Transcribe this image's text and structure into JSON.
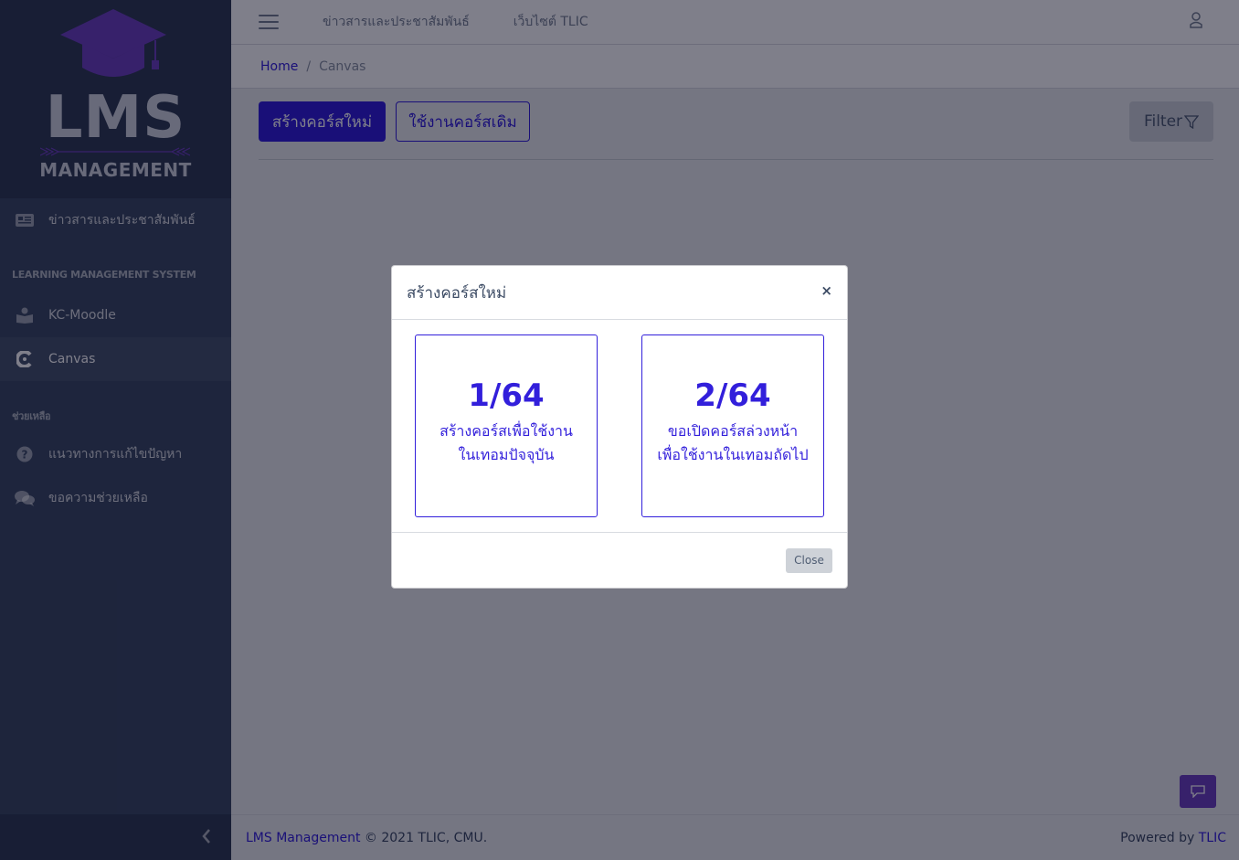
{
  "brand": {
    "title": "LMS",
    "subtitle": "MANAGEMENT"
  },
  "sidebar": {
    "items": [
      {
        "label": "ข่าวสารและประชาสัมพันธ์",
        "icon": "newspaper-icon"
      },
      {
        "label": "KC-Moodle",
        "icon": "reader-icon"
      },
      {
        "label": "Canvas",
        "icon": "canvas-logo-icon",
        "active": true
      },
      {
        "label": "แนวทางการแก้ไขปัญหา",
        "icon": "question-circle-icon"
      },
      {
        "label": "ขอความช่วยเหลือ",
        "icon": "comments-icon"
      }
    ],
    "section_lms": "LEARNING MANAGEMENT SYSTEM",
    "section_help": "ช่วยเหลือ"
  },
  "header": {
    "nav_news": "ข่าวสารและประชาสัมพันธ์",
    "nav_site": "เว็บไซต์ TLIC"
  },
  "breadcrumb": {
    "home": "Home",
    "separator": "/",
    "current": "Canvas"
  },
  "actions": {
    "create_label": "สร้างคอร์สใหม่",
    "existing_label": "ใช้งานคอร์สเดิม",
    "filter_label": "Filter"
  },
  "modal": {
    "title": "สร้างคอร์สใหม่",
    "close_symbol": "×",
    "options": [
      {
        "term": "1/64",
        "line1": "สร้างคอร์สเพื่อใช้งาน",
        "line2": "ในเทอมปัจจุบัน"
      },
      {
        "term": "2/64",
        "line1": "ขอเปิดคอร์สล่วงหน้า",
        "line2": "เพื่อใช้งานในเทอมถัดไป"
      }
    ],
    "close_label": "Close"
  },
  "footer": {
    "app_link": "LMS Management",
    "copyright": " © 2021 TLIC, CMU.",
    "powered_prefix": "Powered by ",
    "powered_link": "TLIC"
  },
  "colors": {
    "primary": "#321fdb",
    "sidebar": "#3c4b64",
    "accent": "#6f42c1"
  }
}
